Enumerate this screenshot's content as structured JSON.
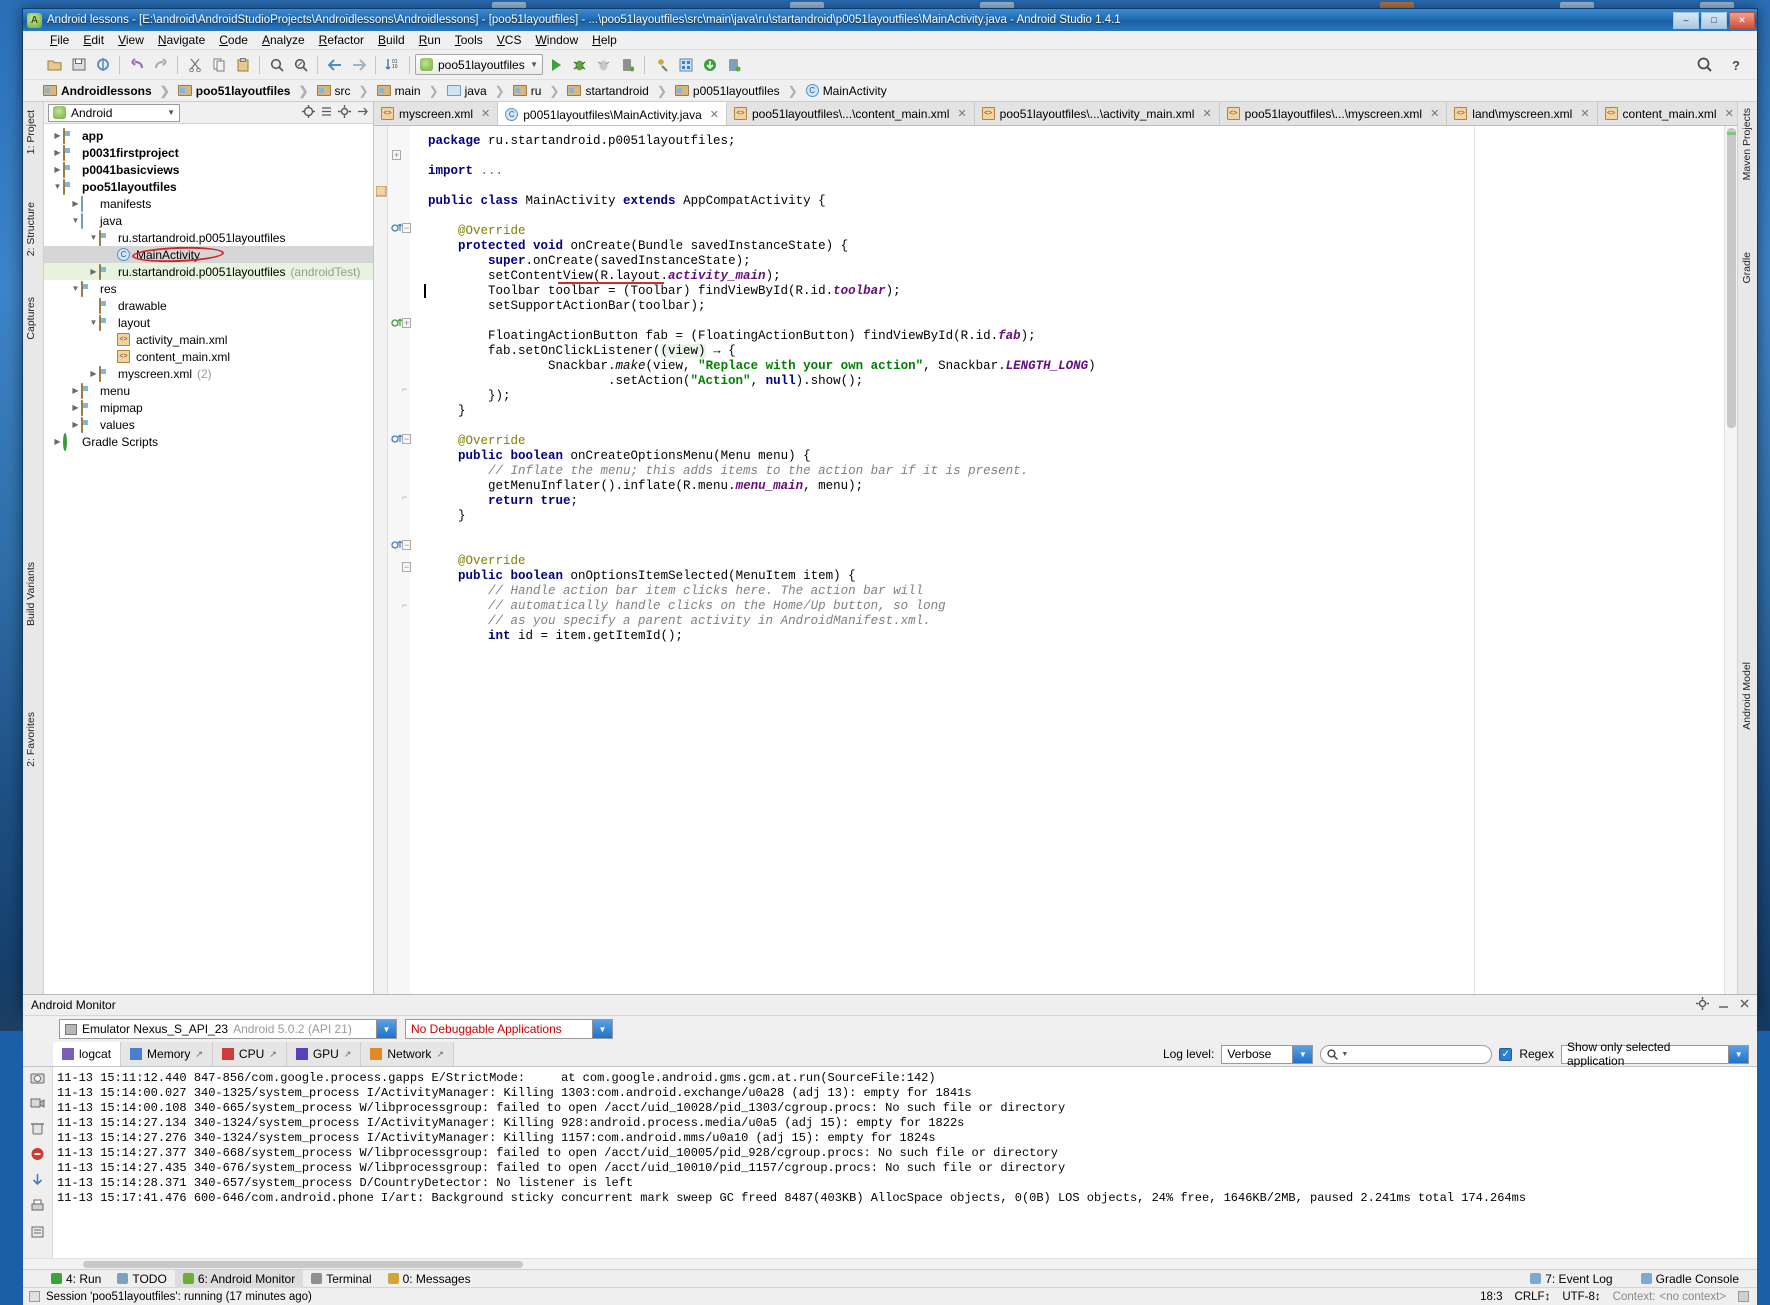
{
  "window": {
    "title": "Android lessons - [E:\\android\\AndroidStudioProjects\\Androidlessons\\Androidlessons] - [poo51layoutfiles] - ...\\poo51layoutfiles\\src\\main\\java\\ru\\startandroid\\p0051layoutfiles\\MainActivity.java - Android Studio 1.4.1",
    "buttons": {
      "minimize": "–",
      "maximize": "□",
      "close": "✕"
    }
  },
  "menubar": {
    "items": [
      "File",
      "Edit",
      "View",
      "Navigate",
      "Code",
      "Analyze",
      "Refactor",
      "Build",
      "Run",
      "Tools",
      "VCS",
      "Window",
      "Help"
    ]
  },
  "toolbar": {
    "run_config": "poo51layoutfiles",
    "icons": [
      "open-folder-icon",
      "save-all-icon",
      "sync-icon",
      "undo-icon",
      "redo-icon",
      "cut-icon",
      "copy-icon",
      "paste-icon",
      "find-icon",
      "replace-icon",
      "back-icon",
      "forward-icon",
      "sort-icon",
      "run-icon",
      "debug-icon",
      "debug-attach-icon",
      "device-icon",
      "sdk-manager-icon",
      "avd-manager-icon",
      "download-icon",
      "device-monitor-icon",
      "search-everywhere-icon",
      "help-icon"
    ]
  },
  "breadcrumbs": [
    {
      "label": "Androidlessons",
      "icon": "module-icon",
      "bold": true
    },
    {
      "label": "poo51layoutfiles",
      "icon": "module-icon",
      "bold": true
    },
    {
      "label": "src",
      "icon": "folder-icon",
      "bold": false
    },
    {
      "label": "main",
      "icon": "folder-icon",
      "bold": false
    },
    {
      "label": "java",
      "icon": "source-folder-icon",
      "bold": false
    },
    {
      "label": "ru",
      "icon": "package-icon",
      "bold": false
    },
    {
      "label": "startandroid",
      "icon": "package-icon",
      "bold": false
    },
    {
      "label": "p0051layoutfiles",
      "icon": "package-icon",
      "bold": false
    },
    {
      "label": "MainActivity",
      "icon": "class-icon",
      "bold": false
    }
  ],
  "left_rail": [
    "1: Project",
    "2: Structure",
    "Captures",
    "Build Variants",
    "2: Favorites"
  ],
  "right_rail": [
    "Maven Projects",
    "Gradle",
    "Android Model"
  ],
  "project_panel": {
    "view_selector": "Android",
    "tools": [
      "target-icon",
      "collapse-all-icon",
      "settings-icon",
      "hide-icon"
    ],
    "tree": [
      {
        "indent": 0,
        "arrow": "▶",
        "icon": "module-icon",
        "label": "app",
        "bold": true,
        "suffix": "",
        "state": "normal"
      },
      {
        "indent": 0,
        "arrow": "▶",
        "icon": "module-icon",
        "label": "p0031firstproject",
        "bold": true,
        "suffix": "",
        "state": "normal"
      },
      {
        "indent": 0,
        "arrow": "▶",
        "icon": "module-icon",
        "label": "p0041basicviews",
        "bold": true,
        "suffix": "",
        "state": "normal"
      },
      {
        "indent": 0,
        "arrow": "▼",
        "icon": "module-icon",
        "label": "poo51layoutfiles",
        "bold": true,
        "suffix": "",
        "state": "normal"
      },
      {
        "indent": 1,
        "arrow": "▶",
        "icon": "folder-blue-icon",
        "label": "manifests",
        "bold": false,
        "suffix": "",
        "state": "normal"
      },
      {
        "indent": 1,
        "arrow": "▼",
        "icon": "folder-blue-icon",
        "label": "java",
        "bold": false,
        "suffix": "",
        "state": "normal"
      },
      {
        "indent": 2,
        "arrow": "▼",
        "icon": "package-icon",
        "label": "ru.startandroid.p0051layoutfiles",
        "bold": false,
        "suffix": "",
        "state": "normal"
      },
      {
        "indent": 3,
        "arrow": "",
        "icon": "class-icon",
        "label": "MainActivity",
        "bold": false,
        "suffix": "",
        "state": "selected"
      },
      {
        "indent": 2,
        "arrow": "▶",
        "icon": "package-icon",
        "label": "ru.startandroid.p0051layoutfiles",
        "bold": false,
        "suffix": "(androidTest)",
        "state": "green"
      },
      {
        "indent": 1,
        "arrow": "▼",
        "icon": "res-folder-icon",
        "label": "res",
        "bold": false,
        "suffix": "",
        "state": "normal"
      },
      {
        "indent": 2,
        "arrow": "",
        "icon": "package-icon",
        "label": "drawable",
        "bold": false,
        "suffix": "",
        "state": "normal"
      },
      {
        "indent": 2,
        "arrow": "▼",
        "icon": "package-icon",
        "label": "layout",
        "bold": false,
        "suffix": "",
        "state": "normal"
      },
      {
        "indent": 3,
        "arrow": "",
        "icon": "xml-icon",
        "label": "activity_main.xml",
        "bold": false,
        "suffix": "",
        "state": "normal"
      },
      {
        "indent": 3,
        "arrow": "",
        "icon": "xml-icon",
        "label": "content_main.xml",
        "bold": false,
        "suffix": "",
        "state": "normal"
      },
      {
        "indent": 2,
        "arrow": "▶",
        "icon": "package-icon",
        "label": "myscreen.xml",
        "bold": false,
        "suffix": "(2)",
        "state": "normal"
      },
      {
        "indent": 1,
        "arrow": "▶",
        "icon": "package-icon",
        "label": "menu",
        "bold": false,
        "suffix": "",
        "state": "normal"
      },
      {
        "indent": 1,
        "arrow": "▶",
        "icon": "package-icon",
        "label": "mipmap",
        "bold": false,
        "suffix": "",
        "state": "normal"
      },
      {
        "indent": 1,
        "arrow": "▶",
        "icon": "package-icon",
        "label": "values",
        "bold": false,
        "suffix": "",
        "state": "normal"
      },
      {
        "indent": 0,
        "arrow": "▶",
        "icon": "gradle-icon",
        "label": "Gradle Scripts",
        "bold": false,
        "suffix": "",
        "state": "normal"
      }
    ]
  },
  "editor_tabs": [
    {
      "label": "myscreen.xml",
      "icon": "xml-icon",
      "active": false
    },
    {
      "label": "p0051layoutfiles\\MainActivity.java",
      "icon": "class-icon",
      "active": true
    },
    {
      "label": "poo51layoutfiles\\...\\content_main.xml",
      "icon": "xml-icon",
      "active": false
    },
    {
      "label": "poo51layoutfiles\\...\\activity_main.xml",
      "icon": "xml-icon",
      "active": false
    },
    {
      "label": "poo51layoutfiles\\...\\myscreen.xml",
      "icon": "xml-icon",
      "active": false
    },
    {
      "label": "land\\myscreen.xml",
      "icon": "xml-icon",
      "active": false
    },
    {
      "label": "content_main.xml",
      "icon": "xml-icon",
      "active": false
    }
  ],
  "editor_tabs_overflow": "3",
  "code_lines": [
    {
      "html": "<span class=\"k\">package</span> ru.startandroid.p0051layoutfiles;"
    },
    {
      "html": ""
    },
    {
      "html": "<span class=\"k\">import</span> <span style=\"color:#3f8f3f\">...</span>"
    },
    {
      "html": ""
    },
    {
      "html": "<span class=\"k\">public class</span> MainActivity <span class=\"k\">extends</span> AppCompatActivity {"
    },
    {
      "html": ""
    },
    {
      "html": "    <span class=\"ann\">@Override</span>"
    },
    {
      "html": "    <span class=\"k\">protected void</span> onCreate(Bundle savedInstanceState) {"
    },
    {
      "html": "        <span class=\"k\">super</span>.onCreate(savedInstanceState);"
    },
    {
      "html": "        setContentView(R.layout.<span class=\"fld\">activity_main</span>);"
    },
    {
      "html": "        Toolbar toolbar = (Toolbar) findViewById(R.id.<span class=\"fld\">toolbar</span>);"
    },
    {
      "html": "        setSupportActionBar(toolbar);"
    },
    {
      "html": ""
    },
    {
      "html": "        FloatingActionButton fab = (FloatingActionButton) findViewById(R.id.<span class=\"fld\">fab</span>);"
    },
    {
      "html": "        fab.setOnClickListener(<span class=\"param\">(view)</span> → {"
    },
    {
      "html": "                Snackbar.<span style=\"font-style:italic\">make</span>(view, <span class=\"str\">\"Replace with your own action\"</span>, Snackbar.<span class=\"fld\">LENGTH_LONG</span>)"
    },
    {
      "html": "                        .setAction(<span class=\"str\">\"Action\"</span>, <span class=\"k\">null</span>).show();"
    },
    {
      "html": "        });"
    },
    {
      "html": "    }"
    },
    {
      "html": ""
    },
    {
      "html": "    <span class=\"ann\">@Override</span>"
    },
    {
      "html": "    <span class=\"k\">public boolean</span> onCreateOptionsMenu(Menu menu) {"
    },
    {
      "html": "        <span class=\"cmt\">// Inflate the menu; this adds items to the action bar if it is present.</span>"
    },
    {
      "html": "        getMenuInflater().inflate(R.menu.<span class=\"fld\">menu_main</span>, menu);"
    },
    {
      "html": "        <span class=\"k\">return true</span>;"
    },
    {
      "html": "    }"
    },
    {
      "html": ""
    },
    {
      "html": ""
    },
    {
      "html": "    <span class=\"ann\">@Override</span>"
    },
    {
      "html": "    <span class=\"k\">public boolean</span> onOptionsItemSelected(MenuItem item) {"
    },
    {
      "html": "        <span class=\"cmt\">// Handle action bar item clicks here. The action bar will</span>"
    },
    {
      "html": "        <span class=\"cmt\">// automatically handle clicks on the Home/Up button, so long</span>"
    },
    {
      "html": "        <span class=\"cmt\">// as you specify a parent activity in AndroidManifest.xml.</span>"
    },
    {
      "html": "        <span class=\"k\">int</span> id = item.getItemId();"
    }
  ],
  "monitor": {
    "title": "Android Monitor",
    "device": "Emulator Nexus_S_API_23",
    "device_detail": "Android 5.0.2 (API 21)",
    "process": "No Debuggable Applications",
    "tabs": [
      {
        "label": "logcat",
        "icon": "logcat-icon",
        "active": true,
        "detach": false
      },
      {
        "label": "Memory",
        "icon": "memory-icon",
        "active": false,
        "detach": true
      },
      {
        "label": "CPU",
        "icon": "cpu-icon",
        "active": false,
        "detach": true
      },
      {
        "label": "GPU",
        "icon": "gpu-icon",
        "active": false,
        "detach": true
      },
      {
        "label": "Network",
        "icon": "network-icon",
        "active": false,
        "detach": true
      }
    ],
    "log_level_label": "Log level:",
    "log_level_value": "Verbose",
    "search_placeholder": "",
    "regex_label": "Regex",
    "regex_checked": true,
    "filter_value": "Show only selected application",
    "log_lines": [
      "11-13 15:11:12.440 847-856/com.google.process.gapps E/StrictMode:     at com.google.android.gms.gcm.at.run(SourceFile:142)",
      "11-13 15:14:00.027 340-1325/system_process I/ActivityManager: Killing 1303:com.android.exchange/u0a28 (adj 13): empty for 1841s",
      "11-13 15:14:00.108 340-665/system_process W/libprocessgroup: failed to open /acct/uid_10028/pid_1303/cgroup.procs: No such file or directory",
      "11-13 15:14:27.134 340-1324/system_process I/ActivityManager: Killing 928:android.process.media/u0a5 (adj 15): empty for 1822s",
      "11-13 15:14:27.276 340-1324/system_process I/ActivityManager: Killing 1157:com.android.mms/u0a10 (adj 15): empty for 1824s",
      "11-13 15:14:27.377 340-668/system_process W/libprocessgroup: failed to open /acct/uid_10005/pid_928/cgroup.procs: No such file or directory",
      "11-13 15:14:27.435 340-676/system_process W/libprocessgroup: failed to open /acct/uid_10010/pid_1157/cgroup.procs: No such file or directory",
      "11-13 15:14:28.371 340-657/system_process D/CountryDetector: No listener is left",
      "11-13 15:17:41.476 600-646/com.android.phone I/art: Background sticky concurrent mark sweep GC freed 8487(403KB) AllocSpace objects, 0(0B) LOS objects, 24% free, 1646KB/2MB, paused 2.241ms total 174.264ms"
    ]
  },
  "bottom_toolwindows": [
    {
      "label": "4: Run",
      "icon": "run-icon",
      "active": false
    },
    {
      "label": "TODO",
      "icon": "todo-icon",
      "active": false
    },
    {
      "label": "6: Android Monitor",
      "icon": "android-icon",
      "active": true
    },
    {
      "label": "Terminal",
      "icon": "terminal-icon",
      "active": false
    },
    {
      "label": "0: Messages",
      "icon": "messages-icon",
      "active": false
    }
  ],
  "bottom_right": [
    {
      "label": "7: Event Log",
      "icon": "event-log-icon"
    },
    {
      "label": "Gradle Console",
      "icon": "gradle-console-icon"
    }
  ],
  "statusbar": {
    "message": "Session 'poo51layoutfiles': running (17 minutes ago)",
    "caret": "18:3",
    "line_separator": "CRLF↕",
    "encoding": "UTF-8↕",
    "context_label": "Context:",
    "context_value": "<no context>"
  },
  "colors": {
    "accent_blue": "#1f72cd",
    "title_blue": "#1a5fa3",
    "red_highlight": "#d4252a",
    "error_red": "#cc0000",
    "string_green": "#008000",
    "keyword_navy": "#000080",
    "field_purple": "#660e7a",
    "comment_gray": "#808080"
  }
}
